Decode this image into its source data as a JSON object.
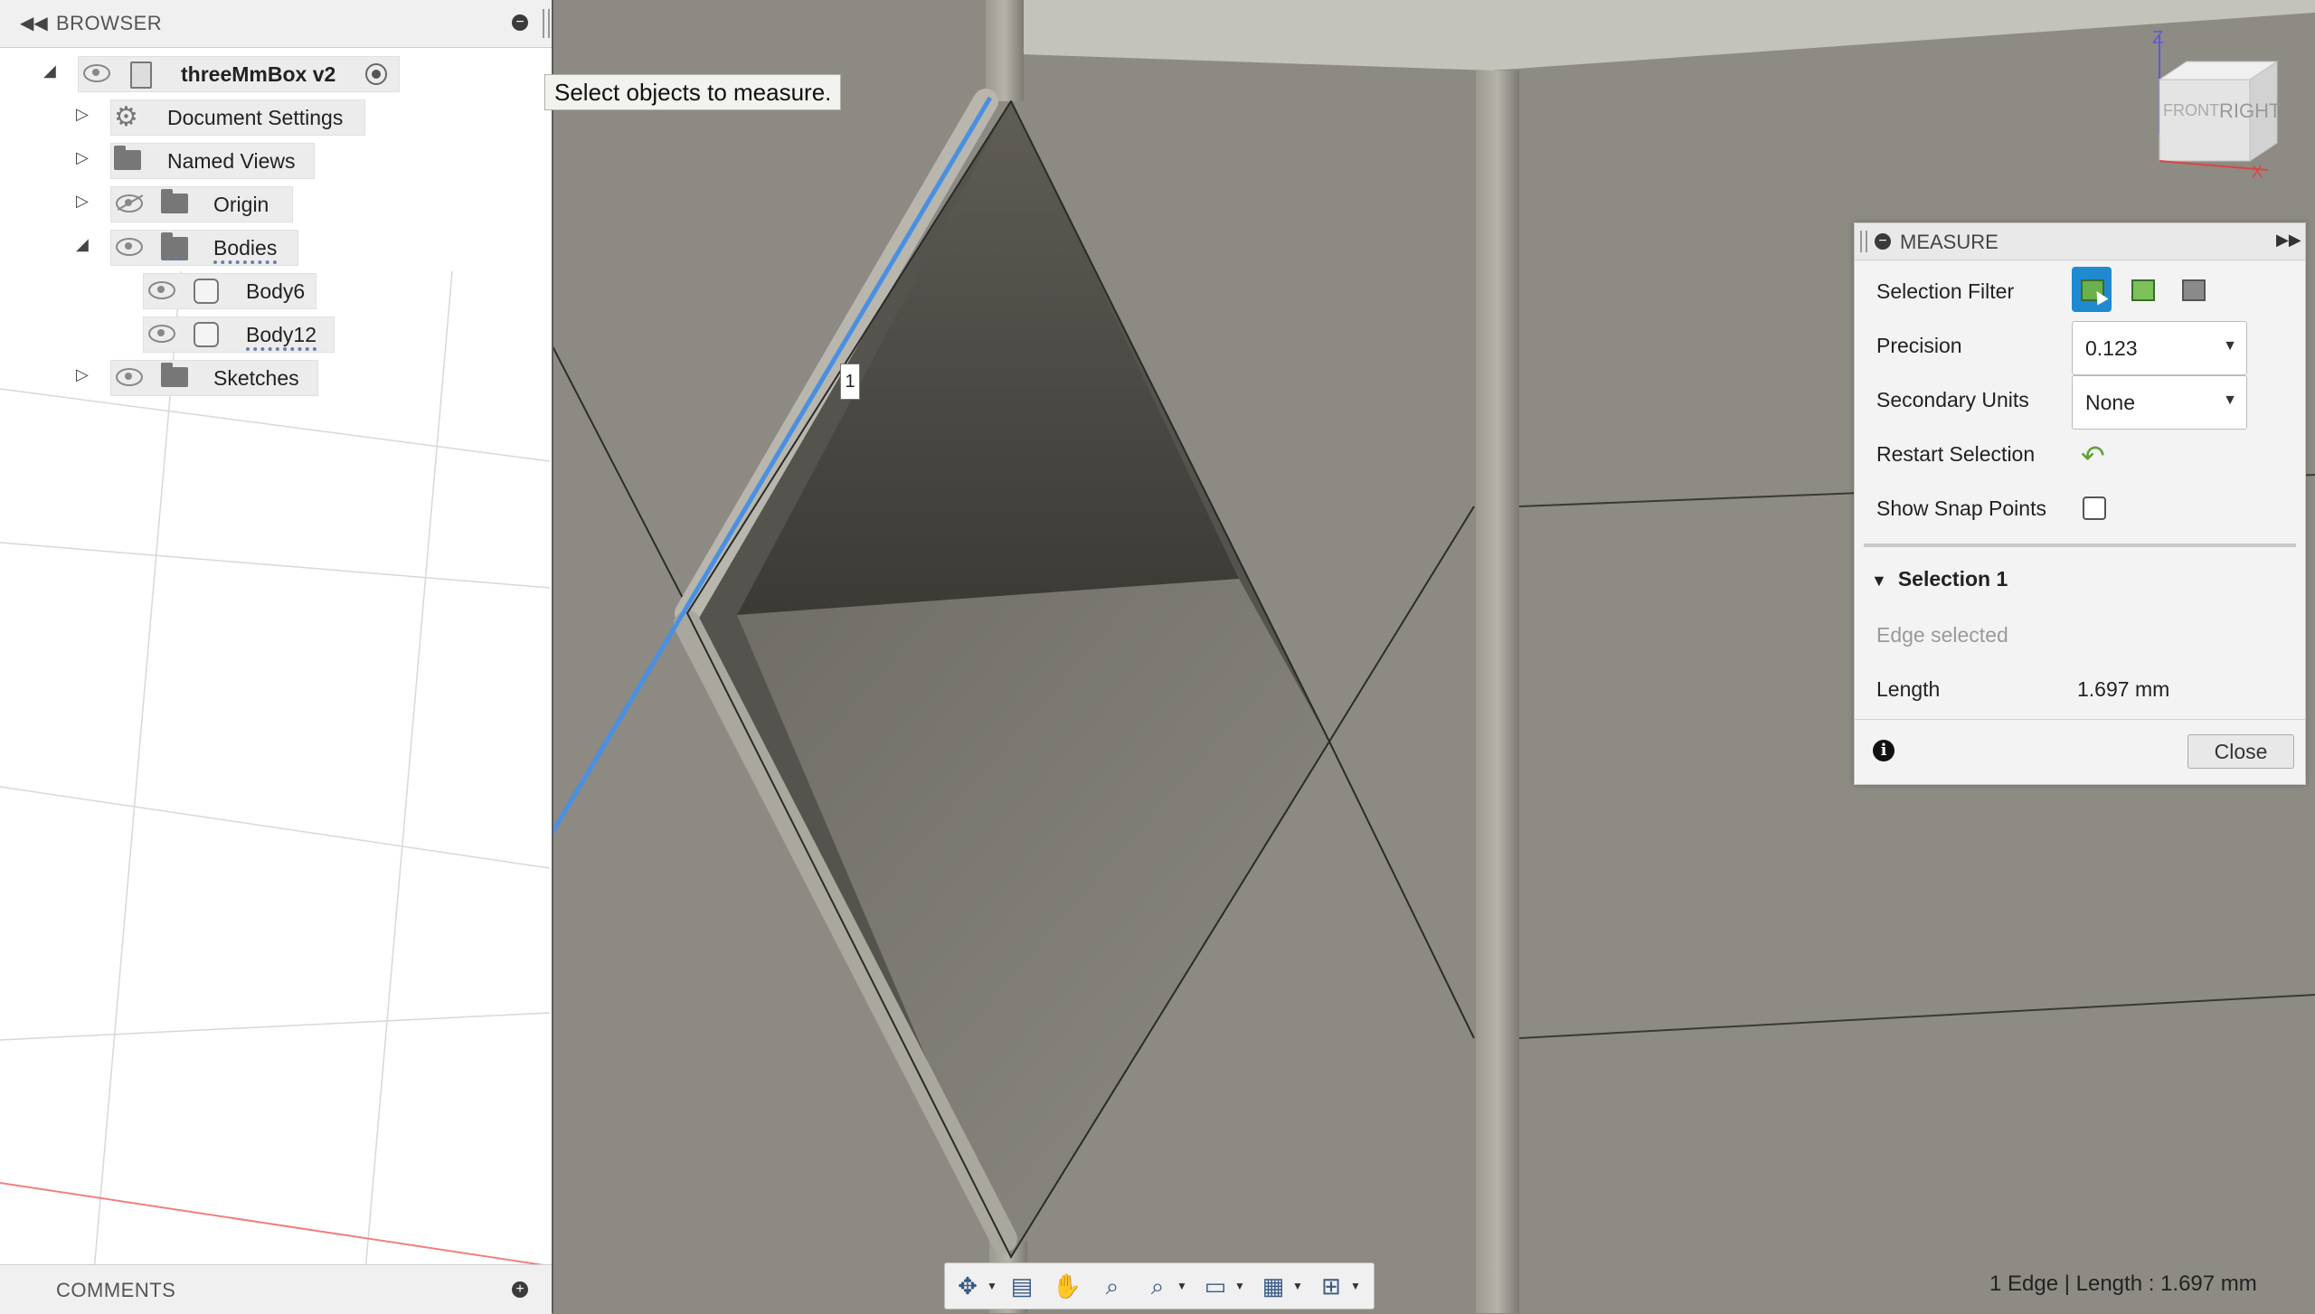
{
  "browser": {
    "title": "BROWSER",
    "collapse_icon": "double-left-arrow",
    "items": [
      {
        "label": "threeMmBox v2",
        "expanded": true
      },
      {
        "label": "Document Settings",
        "expanded": false
      },
      {
        "label": "Named Views",
        "expanded": false
      },
      {
        "label": "Origin",
        "expanded": false,
        "hidden": true
      },
      {
        "label": "Bodies",
        "expanded": true
      },
      {
        "label": "Body6"
      },
      {
        "label": "Body12"
      },
      {
        "label": "Sketches",
        "expanded": false
      }
    ]
  },
  "comments": {
    "title": "COMMENTS"
  },
  "tooltip": {
    "text": "Select objects to measure."
  },
  "point_label": "1",
  "measure": {
    "title": "MEASURE",
    "selection_filter_label": "Selection Filter",
    "precision_label": "Precision",
    "precision_value": "0.123",
    "secondary_units_label": "Secondary Units",
    "secondary_units_value": "None",
    "restart_selection_label": "Restart Selection",
    "show_snap_points_label": "Show Snap Points",
    "show_snap_points_checked": false,
    "selection_header": "Selection 1",
    "edge_selected_text": "Edge selected",
    "length_label": "Length",
    "length_value": "1.697 mm",
    "close_label": "Close",
    "accent_color": "#1f8ad0"
  },
  "viewcube": {
    "front": "FRONT",
    "right": "RIGHT",
    "z_axis": "Z",
    "x_axis": "X"
  },
  "status_bar": {
    "text": "1 Edge | Length : 1.697 mm"
  },
  "colors": {
    "selected_edge": "#4a90e2",
    "model_surface": "#8c8a82",
    "browser_bg": "#ffffff"
  }
}
